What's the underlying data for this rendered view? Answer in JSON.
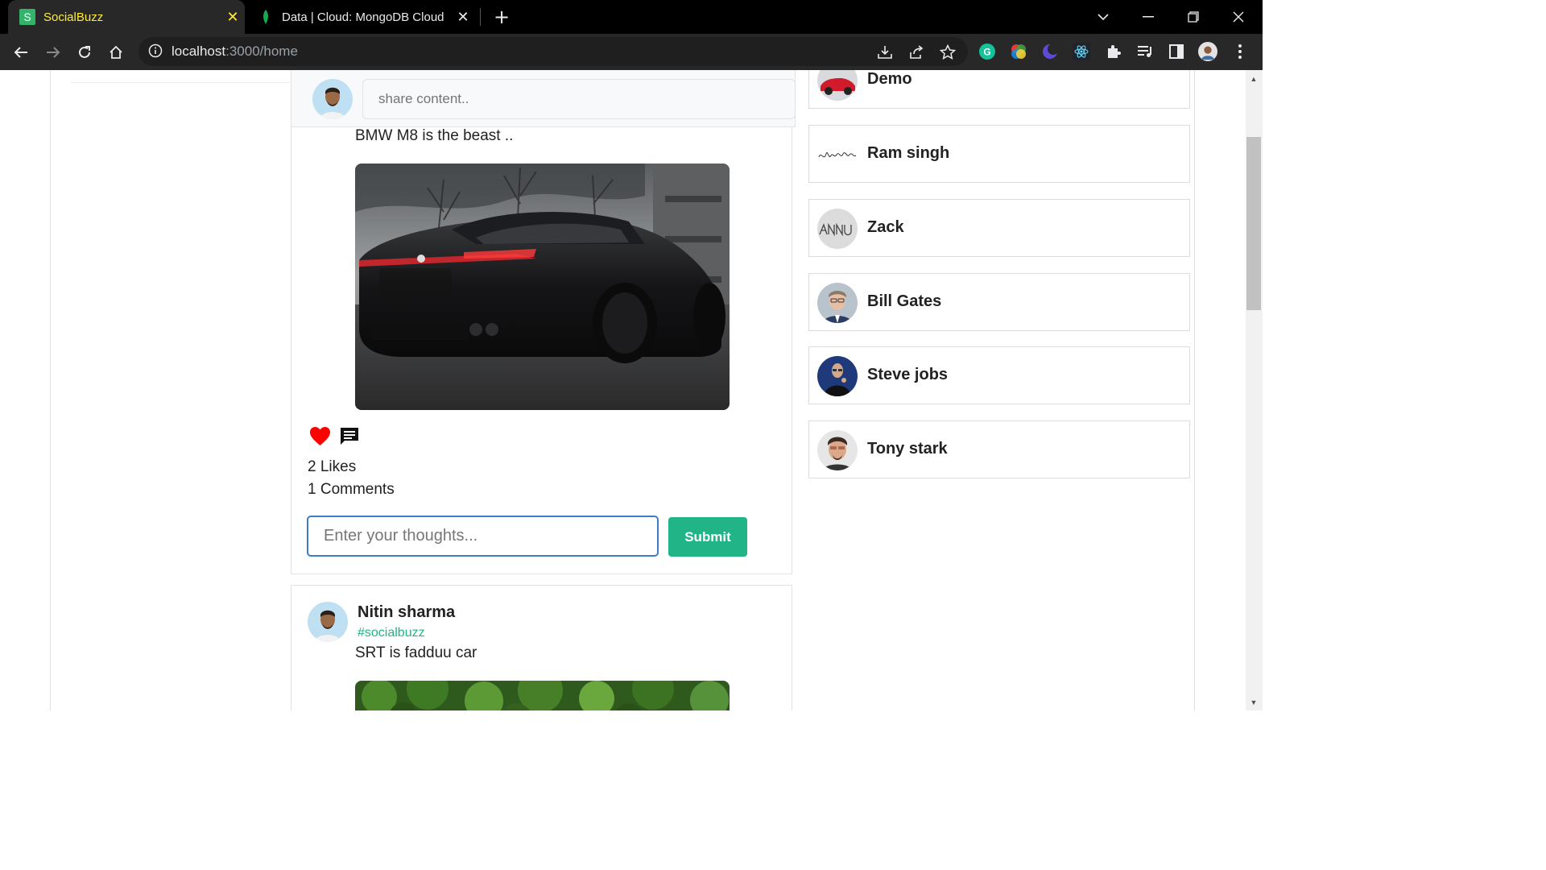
{
  "browser": {
    "tabs": [
      {
        "title": "SocialBuzz",
        "favicon": "socialbuzz-s-icon",
        "active": true
      },
      {
        "title": "Data | Cloud: MongoDB Cloud",
        "favicon": "mongodb-leaf-icon",
        "active": false
      }
    ],
    "url_host": "localhost",
    "url_path": ":3000/home",
    "colors": {
      "tabstrip": "#000000",
      "toolbar": "#282828",
      "active_tab_text": "#ffeb3b"
    }
  },
  "composer": {
    "placeholder": "share content.."
  },
  "posts": [
    {
      "caption": "BMW M8 is the beast ..",
      "image": "black-bmw-m8-photo",
      "likes_text": "2 Likes",
      "comments_text": "1 Comments",
      "comment_placeholder": "Enter your thoughts...",
      "submit_label": "Submit"
    },
    {
      "author": "Nitin sharma",
      "tag": "#socialbuzz",
      "caption": "SRT is fadduu car",
      "image": "green-trees-photo"
    }
  ],
  "users": [
    {
      "name": "Demo",
      "avatar": "red-car-avatar"
    },
    {
      "name": "Ram singh",
      "avatar": "signature-avatar"
    },
    {
      "name": "Zack",
      "avatar": "annu-handwriting-avatar"
    },
    {
      "name": "Bill Gates",
      "avatar": "bill-gates-avatar"
    },
    {
      "name": "Steve jobs",
      "avatar": "steve-jobs-avatar"
    },
    {
      "name": "Tony stark",
      "avatar": "tony-stark-avatar"
    }
  ],
  "theme": {
    "accent": "#20b486",
    "focus_border": "#3f7bc6",
    "like": "#ff0000"
  }
}
